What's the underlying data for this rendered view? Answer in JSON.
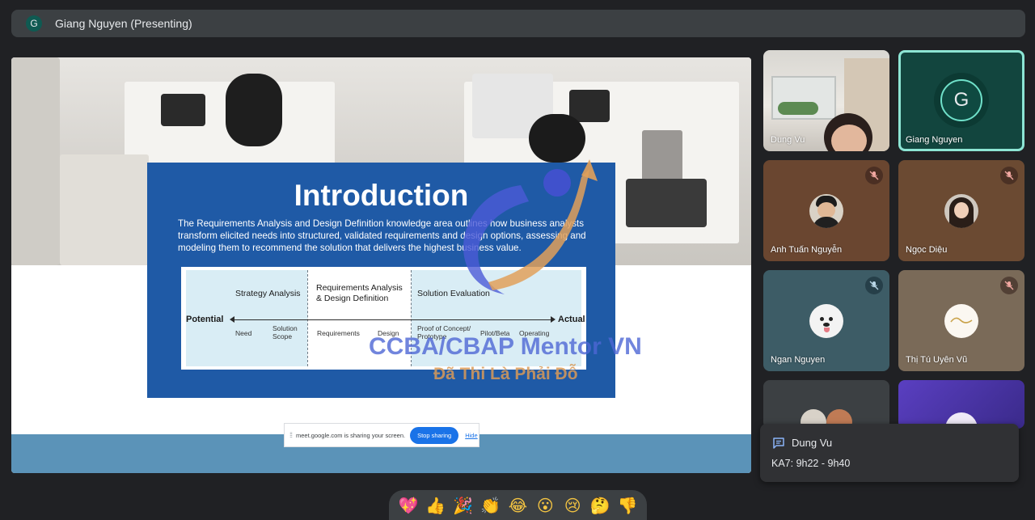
{
  "header": {
    "avatar_letter": "G",
    "title": "Giang Nguyen (Presenting)"
  },
  "slide": {
    "title": "Introduction",
    "body": "The Requirements Analysis and Design Definition knowledge area outlines how business analysts transform elicited needs into structured, validated requirements and design options, assessing and modeling them to recommend the solution that delivers the highest business value.",
    "diagram": {
      "left_label": "Potential",
      "right_label": "Actual",
      "phases": [
        "Strategy Analysis",
        "Requirements Analysis & Design Definition",
        "Solution Evaluation"
      ],
      "steps": [
        "Need",
        "Solution Scope",
        "Requirements",
        "Design",
        "Proof of Concept/ Prototype",
        "Pilot/Beta",
        "Operating"
      ]
    },
    "watermark": {
      "line1": "CCBA/CBAP Mentor VN",
      "line2": "Đã Thi Là Phải Đỗ"
    }
  },
  "sharebar": {
    "message": "meet.google.com is sharing your screen.",
    "stop_label": "Stop sharing",
    "hide_label": "Hide"
  },
  "participants": [
    {
      "name": "Dung Vu",
      "muted": false
    },
    {
      "name": "Giang Nguyen",
      "muted": false,
      "avatar_letter": "G"
    },
    {
      "name": "Anh Tuấn Nguyễn",
      "muted": true
    },
    {
      "name": "Ngọc Diệu",
      "muted": true
    },
    {
      "name": "Ngan Nguyen",
      "muted": true
    },
    {
      "name": "Thị Tú Uyên Vũ",
      "muted": true
    }
  ],
  "chat_popup": {
    "sender": "Dung Vu",
    "message": "KA7: 9h22 - 9h40"
  },
  "reactions": [
    "💖",
    "👍",
    "🎉",
    "👏",
    "😂",
    "😮",
    "😢",
    "🤔",
    "👎"
  ],
  "colors": {
    "accent": "#1a73e8",
    "speaking_ring": "#8de5d4",
    "slide_blue": "#1f5aa6"
  },
  "icons": [
    "mic-off-icon",
    "chat-icon",
    "drag-handle-icon"
  ]
}
